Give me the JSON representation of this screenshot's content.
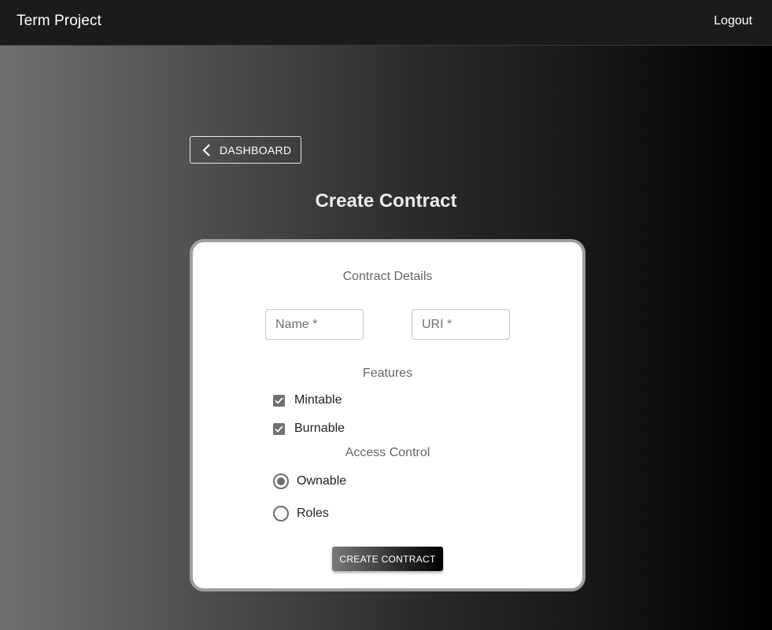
{
  "appbar": {
    "title": "Term Project",
    "logout_label": "Logout"
  },
  "back_button": {
    "label": "DASHBOARD",
    "icon": "chevron-left-icon"
  },
  "page_title": "Create Contract",
  "form": {
    "details_heading": "Contract Details",
    "name_field": {
      "placeholder": "Name *",
      "value": ""
    },
    "uri_field": {
      "placeholder": "URI *",
      "value": ""
    },
    "features_heading": "Features",
    "features": [
      {
        "label": "Mintable",
        "checked": true
      },
      {
        "label": "Burnable",
        "checked": true
      }
    ],
    "access_heading": "Access Control",
    "access_options": [
      {
        "label": "Ownable",
        "selected": true
      },
      {
        "label": "Roles",
        "selected": false
      }
    ],
    "submit_label": "CREATE CONTRACT"
  },
  "colors": {
    "appbar_bg": "#1b1b1b",
    "card_border": "#9e9e9e",
    "control_gray": "#707070"
  }
}
